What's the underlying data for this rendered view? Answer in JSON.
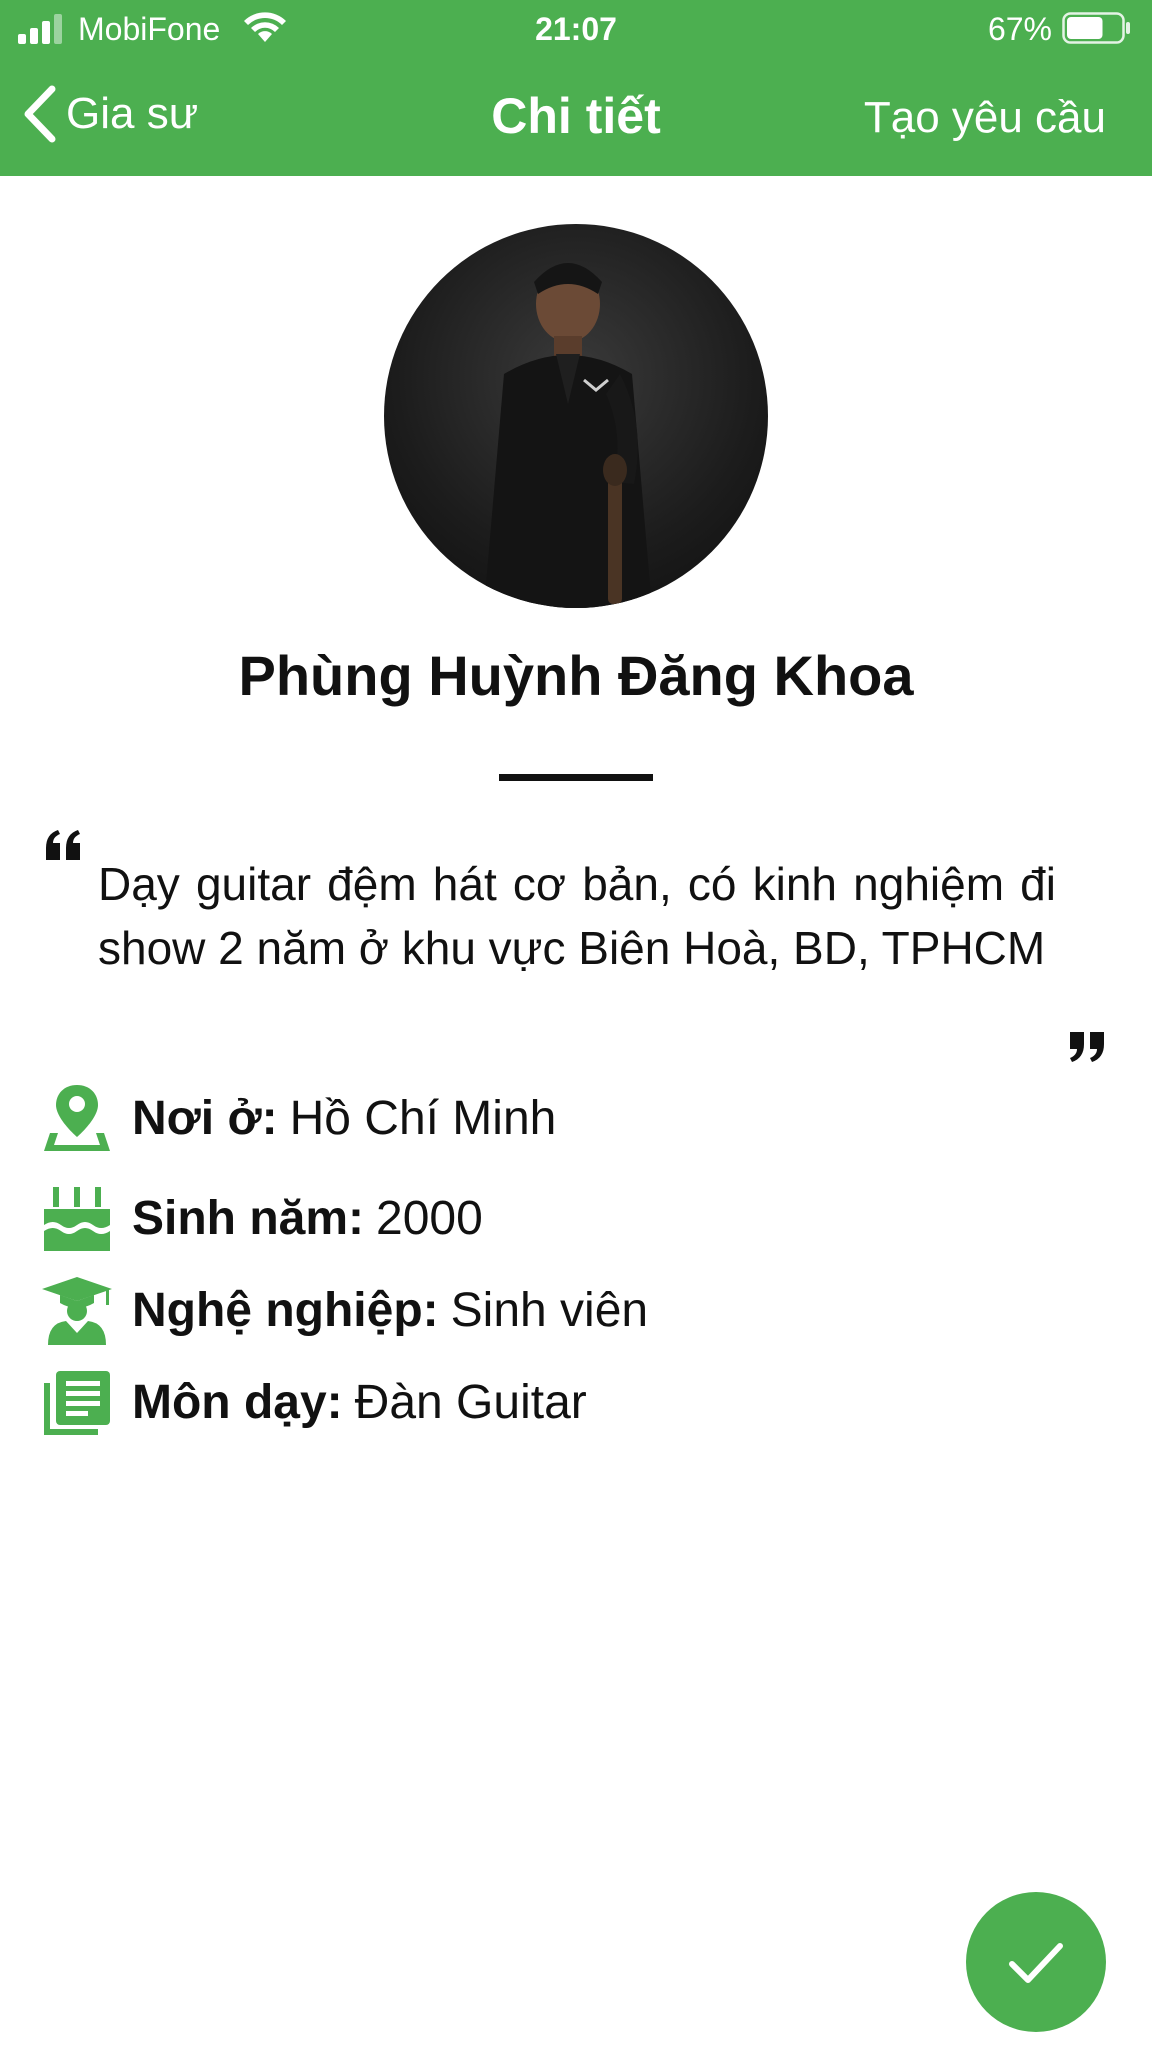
{
  "status_bar": {
    "carrier": "MobiFone",
    "time": "21:07",
    "battery_percent": "67%",
    "battery_level": 0.67
  },
  "nav": {
    "back_label": "Gia sư",
    "title": "Chi tiết",
    "action_label": "Tạo yêu cầu"
  },
  "profile": {
    "name": "Phùng Huỳnh Đăng Khoa",
    "quote": "Dạy guitar đệm hát cơ bản, có kinh nghiệm đi show 2 năm ở khu vực Biên Hoà, BD, TPHCM"
  },
  "info": [
    {
      "icon": "location-pin-icon",
      "label": "Nơi ở:",
      "value": "Hồ Chí Minh"
    },
    {
      "icon": "birthday-cake-icon",
      "label": "Sinh năm:",
      "value": "2000"
    },
    {
      "icon": "graduate-icon",
      "label": "Nghệ nghiệp:",
      "value": "Sinh viên"
    },
    {
      "icon": "document-icon",
      "label": "Môn dạy:",
      "value": "Đàn Guitar"
    }
  ],
  "colors": {
    "accent": "#4caf50",
    "text": "#111111",
    "background": "#ffffff"
  }
}
